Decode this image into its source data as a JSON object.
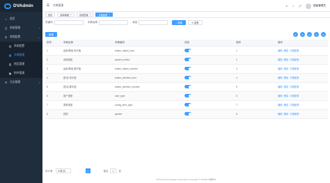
{
  "app": {
    "logo_text": "DVAdmin"
  },
  "sidebar": {
    "items": [
      {
        "icon": "⌂",
        "label": "首页"
      },
      {
        "icon": "◫",
        "label": "系统管理",
        "arrow": "›"
      },
      {
        "icon": "⚙",
        "label": "常规配置",
        "arrow": "⌄"
      },
      {
        "icon": "▤",
        "label": "系统配置"
      },
      {
        "icon": "▦",
        "label": "字典管理"
      },
      {
        "icon": "▥",
        "label": "地区管理"
      },
      {
        "icon": "▣",
        "label": "附件管理"
      },
      {
        "icon": "☰",
        "label": "日志管理",
        "arrow": "›"
      }
    ]
  },
  "header": {
    "breadcrumb": "字典管理",
    "icons": {
      "search": "⌕",
      "bell": "♪",
      "fullscreen": "⤢"
    },
    "username": "超级管理员"
  },
  "tags": [
    {
      "label": "首页"
    },
    {
      "label": "菜单管理",
      "close": "×"
    },
    {
      "label": "系统配置",
      "close": "×"
    },
    {
      "label": "字典管理",
      "close": "×"
    }
  ],
  "filters": {
    "key_label": "关键词",
    "key_placeholder": "",
    "name_label": "字典名称",
    "name_placeholder": "",
    "status_label": "状态",
    "status_placeholder": "",
    "search_btn": "搜索",
    "reset_btn": "重置"
  },
  "toolbar": {
    "add_btn": "新增",
    "tools": [
      "⟳",
      "⚲",
      "⊞",
      "≡",
      "⇅"
    ]
  },
  "table": {
    "headers": [
      "序号",
      "字典名称",
      "字典编号",
      "状态",
      "排序",
      "操作"
    ],
    "rows": [
      {
        "no": "1",
        "name": "启用/禁用-布尔值",
        "code": "button_status_bool",
        "sort": "1"
      },
      {
        "no": "2",
        "name": "系统按钮",
        "code": "system_button",
        "sort": "2"
      },
      {
        "no": "3",
        "name": "启用/禁用-数字值",
        "code": "button_status_number",
        "sort": "3"
      },
      {
        "no": "4",
        "name": "是/否-布尔值",
        "code": "button_whether_bool",
        "sort": "4"
      },
      {
        "no": "5",
        "name": "是/否-数字值",
        "code": "button_whether_number",
        "sort": "5"
      },
      {
        "no": "6",
        "name": "用户类型",
        "code": "user_type",
        "sort": "6"
      },
      {
        "no": "7",
        "name": "表单类型",
        "code": "config_form_type",
        "sort": "7"
      },
      {
        "no": "8",
        "name": "性别",
        "code": "gender",
        "sort": "8"
      }
    ],
    "ops": [
      "编辑",
      "删除",
      "字典配置"
    ]
  },
  "pager": {
    "total": "共 8 条",
    "page_size": "20条/页",
    "prev": "‹",
    "current": "1",
    "next": "›",
    "goto_label": "前往",
    "goto_value": "1",
    "goto_suffix": "页"
  },
  "footer": {
    "text": "Powered by Django-Vue3-Admin Copyright © DVAdmin團隊"
  }
}
